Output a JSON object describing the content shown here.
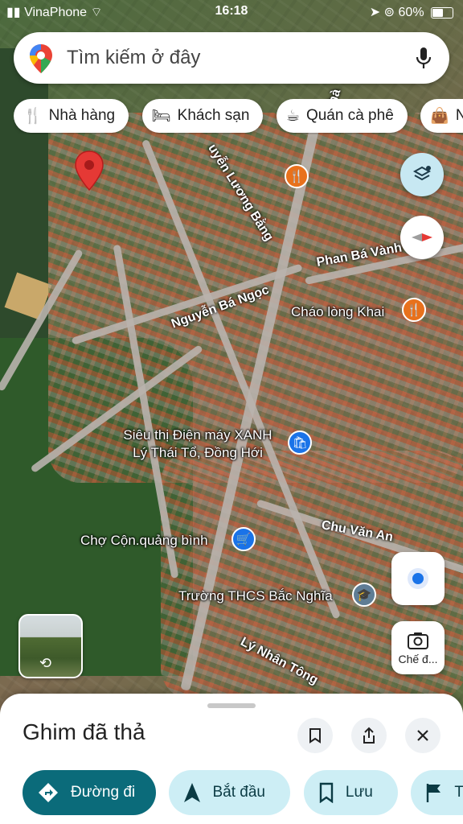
{
  "status": {
    "carrier": "VinaPhone",
    "time": "16:18",
    "battery": "60%",
    "battery_level": 0.6
  },
  "search": {
    "placeholder": "Tìm kiếm ở đây"
  },
  "chips": [
    {
      "label": "Nhà hàng",
      "icon": "restaurant-icon"
    },
    {
      "label": "Khách sạn",
      "icon": "hotel-icon"
    },
    {
      "label": "Quán cà phê",
      "icon": "coffee-icon"
    },
    {
      "label": "N",
      "icon": "shopping-bag-icon"
    }
  ],
  "map": {
    "streets": {
      "nguyen_luong_bang": "uyễn Lương Bằng",
      "phan_ba_vanh": "Phan Bá Vành",
      "nguyen_ba_ngoc": "Nguyễn Bá Ngọc",
      "chu_van_an": "Chu Văn An",
      "ly_nhan_tong": "Lý Nhân Tông",
      "top_fragment": "hà"
    },
    "places": {
      "chao_long": "Cháo lòng Khai",
      "sieu_thi_line1": "Siêu thị Điện máy XANH",
      "sieu_thi_line2": "Lý Thái Tổ, Đồng Hới",
      "cho_con": "Chợ Cộn.quảng bình",
      "truong": "Trường THCS Bắc Nghĩa"
    },
    "colors": {
      "restaurant": "#e8711c",
      "shop": "#1a73e8",
      "school": "#5f7d95",
      "pin": "#e53935"
    }
  },
  "lens_label": "Chế đ...",
  "sheet": {
    "title": "Ghim đã thả",
    "actions": {
      "directions": "Đường đi",
      "start": "Bắt đầu",
      "save": "Lưu",
      "more": "Th"
    }
  }
}
